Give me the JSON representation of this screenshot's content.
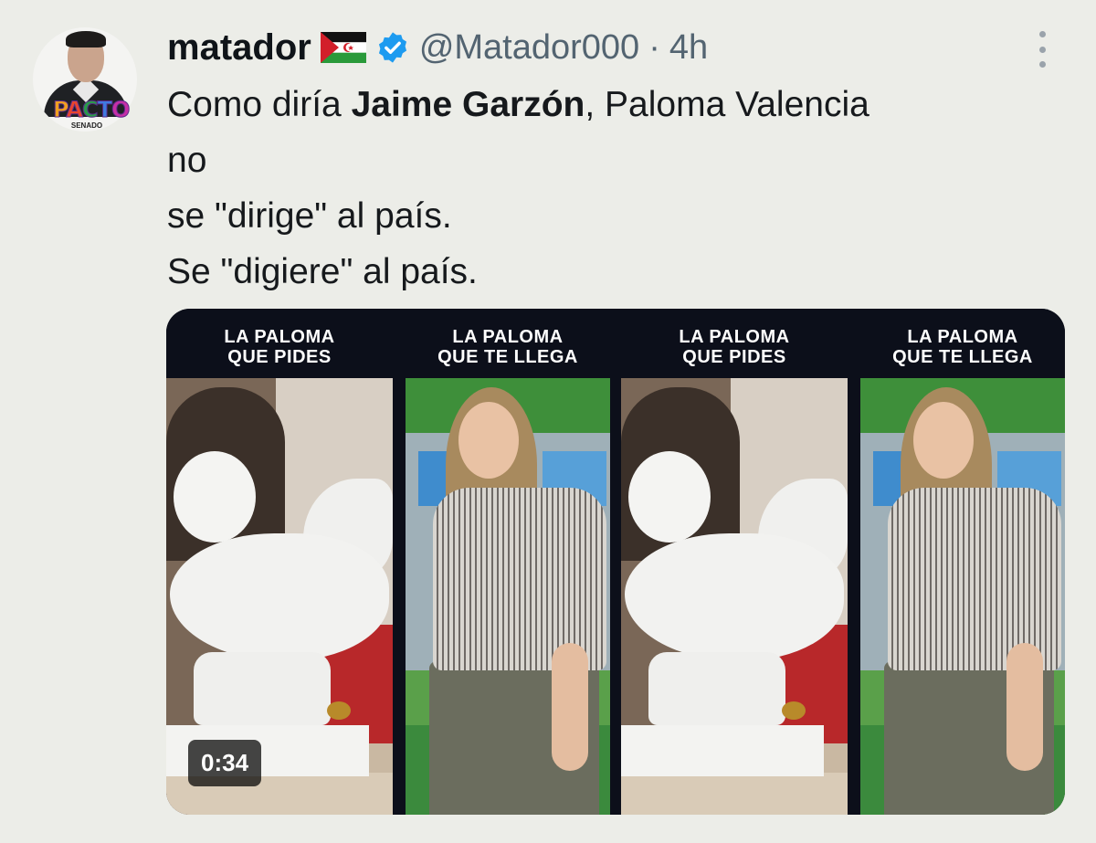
{
  "author": {
    "display_name": "matador",
    "flag_emoji_name": "western-sahara-flag",
    "verified": true,
    "handle": "@Matador000",
    "separator": "·",
    "time": "4h",
    "avatar_logo": {
      "text": "PACTO",
      "subtext": "SENADO"
    }
  },
  "tweet": {
    "line1_pre": "Como diría ",
    "line1_bold": "Jaime Garzón",
    "line1_post": ", Paloma Valencia",
    "line2": "no",
    "line3": "se \"dirige\" al país.",
    "line4": "Se \"digiere\" al país."
  },
  "media": {
    "panels": [
      {
        "left_caption": [
          "LA PALOMA",
          "QUE PIDES"
        ],
        "right_caption": [
          "LA PALOMA",
          "QUE TE LLEGA"
        ],
        "duration": "0:34"
      },
      {
        "left_caption": [
          "LA PALOMA",
          "QUE PIDES"
        ],
        "right_caption": [
          "LA PALOMA",
          "QUE TE LLEGA"
        ]
      }
    ]
  },
  "colors": {
    "background": "#ecede8",
    "verified_blue": "#1d9bf0",
    "handle_gray": "#536471",
    "media_dark": "#0c0f1a"
  }
}
